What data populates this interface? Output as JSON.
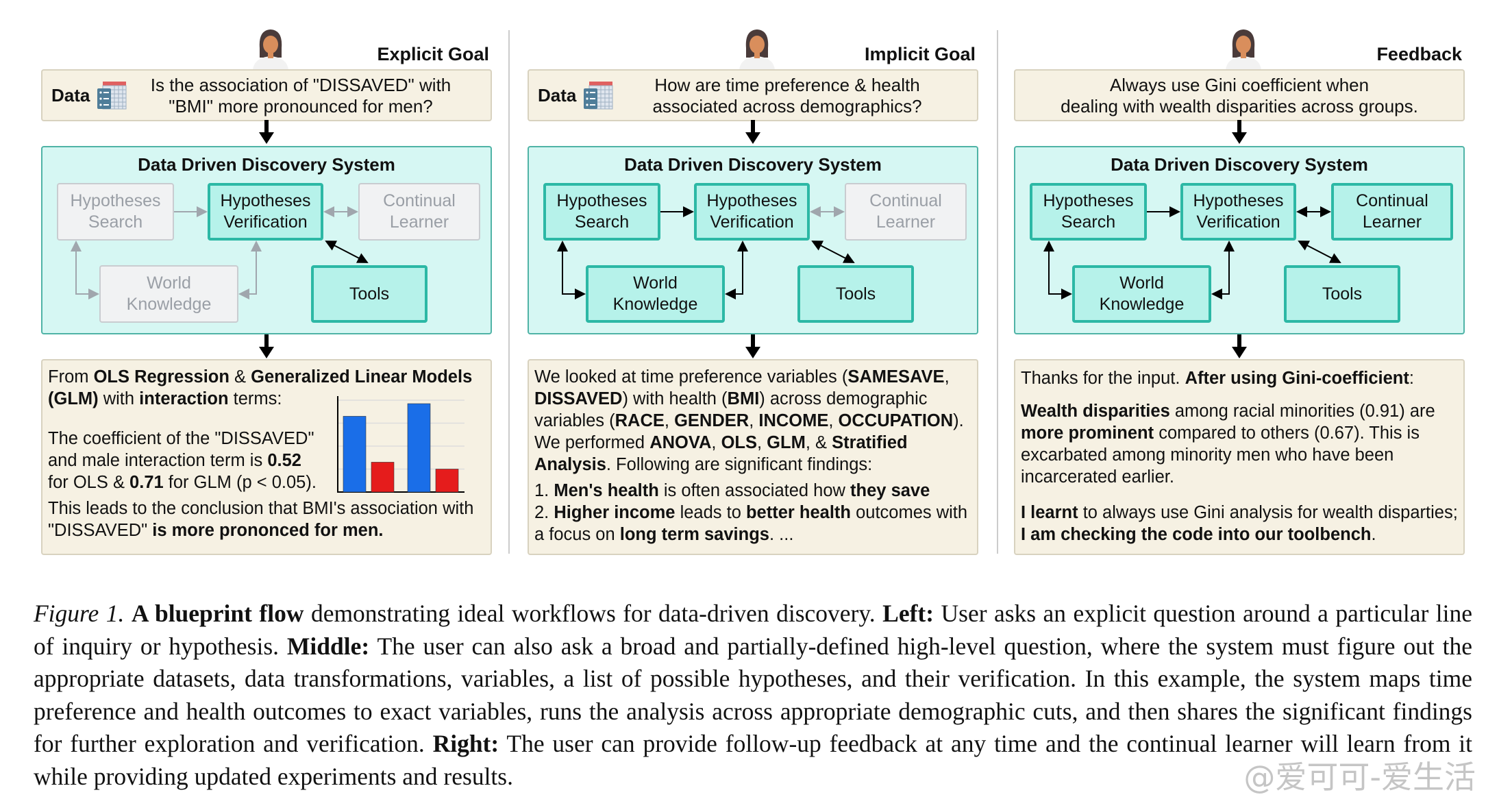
{
  "panels": [
    {
      "goal_label": "Explicit Goal",
      "data_label": "Data",
      "question_lines": [
        "Is  the association of \"DISSAVED\" with",
        "\"BMI\" more pronounced for men?"
      ],
      "system_title": "Data Driven Discovery System",
      "modules": {
        "hs": {
          "label": "Hypotheses\nSearch",
          "active": false
        },
        "hv": {
          "label": "Hypotheses\nVerification",
          "active": true
        },
        "cl": {
          "label": "Continual\nLearner",
          "active": false
        },
        "wk": {
          "label": "World\nKnowledge",
          "active": false
        },
        "tools": {
          "label": "Tools",
          "active": true
        }
      },
      "result_paragraphs": [
        [
          [
            {
              "t": "From "
            },
            {
              "t": "OLS Regression",
              "b": true
            },
            {
              "t": " & "
            },
            {
              "t": "Generalized Linear Models",
              "b": true
            }
          ],
          [
            {
              "t": "(GLM)",
              "b": true
            },
            {
              "t": " with "
            },
            {
              "t": "interaction",
              "b": true
            },
            {
              "t": " terms:"
            }
          ]
        ],
        [
          [
            {
              "t": "The coefficient of the \"DISSAVED\""
            }
          ],
          [
            {
              "t": "and male interaction term is "
            },
            {
              "t": "0.52",
              "b": true
            }
          ],
          [
            {
              "t": "for OLS & "
            },
            {
              "t": "0.71",
              "b": true
            },
            {
              "t": " for GLM  (p < 0.05)."
            }
          ]
        ],
        [
          [
            {
              "t": "This leads to the conclusion that BMI's association with"
            }
          ],
          [
            {
              "t": "\"DISSAVED\" "
            },
            {
              "t": "is more prononced for men.",
              "b": true
            }
          ]
        ]
      ]
    },
    {
      "goal_label": "Implicit Goal",
      "data_label": "Data",
      "question_lines": [
        "How are time preference & health",
        "associated across demographics?"
      ],
      "system_title": "Data Driven Discovery System",
      "modules": {
        "hs": {
          "label": "Hypotheses\nSearch",
          "active": true
        },
        "hv": {
          "label": "Hypotheses\nVerification",
          "active": true
        },
        "cl": {
          "label": "Continual\nLearner",
          "active": false
        },
        "wk": {
          "label": "World\nKnowledge",
          "active": true
        },
        "tools": {
          "label": "Tools",
          "active": true
        }
      },
      "result_paragraphs": [
        [
          [
            {
              "t": "We looked at time preference variables ("
            },
            {
              "t": "SAMESAVE",
              "b": true
            },
            {
              "t": ","
            }
          ],
          [
            {
              "t": "DISSAVED",
              "b": true
            },
            {
              "t": ") with health ("
            },
            {
              "t": "BMI",
              "b": true
            },
            {
              "t": ") across demographic"
            }
          ],
          [
            {
              "t": "variables ("
            },
            {
              "t": "RACE",
              "b": true
            },
            {
              "t": ", "
            },
            {
              "t": "GENDER",
              "b": true
            },
            {
              "t": ", "
            },
            {
              "t": "INCOME",
              "b": true
            },
            {
              "t": ", "
            },
            {
              "t": "OCCUPATION",
              "b": true
            },
            {
              "t": ")."
            }
          ],
          [
            {
              "t": "We performed "
            },
            {
              "t": "ANOVA",
              "b": true
            },
            {
              "t": ", "
            },
            {
              "t": "OLS",
              "b": true
            },
            {
              "t": ", "
            },
            {
              "t": "GLM",
              "b": true
            },
            {
              "t": ", & "
            },
            {
              "t": "Stratified",
              "b": true
            }
          ],
          [
            {
              "t": "Analysis",
              "b": true
            },
            {
              "t": ". Following are significant findings:"
            }
          ]
        ],
        [
          [
            {
              "t": "1. "
            },
            {
              "t": "Men's health",
              "b": true
            },
            {
              "t": " is often associated how "
            },
            {
              "t": "they save",
              "b": true
            }
          ],
          [
            {
              "t": "2. "
            },
            {
              "t": "Higher income",
              "b": true
            },
            {
              "t": " leads to "
            },
            {
              "t": "better health",
              "b": true
            },
            {
              "t": " outcomes with"
            }
          ],
          [
            {
              "t": "a focus on "
            },
            {
              "t": "long term savings",
              "b": true
            },
            {
              "t": ".  ..."
            }
          ]
        ]
      ]
    },
    {
      "goal_label": "Feedback",
      "question_lines": [
        "Always use Gini coefficient when",
        "dealing with wealth disparities across groups."
      ],
      "system_title": "Data Driven Discovery System",
      "modules": {
        "hs": {
          "label": "Hypotheses\nSearch",
          "active": true
        },
        "hv": {
          "label": "Hypotheses\nVerification",
          "active": true
        },
        "cl": {
          "label": "Continual\nLearner",
          "active": true
        },
        "wk": {
          "label": "World\nKnowledge",
          "active": true
        },
        "tools": {
          "label": "Tools",
          "active": true
        }
      },
      "result_paragraphs": [
        [
          [
            {
              "t": "Thanks for the input. "
            },
            {
              "t": "After using Gini-coefficient",
              "b": true
            },
            {
              "t": ":"
            }
          ]
        ],
        [
          [
            {
              "t": "Wealth disparities",
              "b": true
            },
            {
              "t": " among racial minorities (0.91) are"
            }
          ],
          [
            {
              "t": "more prominent",
              "b": true
            },
            {
              "t": " compared to others (0.67). This is"
            }
          ],
          [
            {
              "t": "excarbated among minority men who have been"
            }
          ],
          [
            {
              "t": "incarcerated earlier."
            }
          ]
        ],
        [
          [
            {
              "t": "I learnt",
              "b": true
            },
            {
              "t": " to always use Gini analysis for wealth disparties;"
            }
          ],
          [
            {
              "t": "I am checking the code into our toolbench",
              "b": true
            },
            {
              "t": "."
            }
          ]
        ]
      ]
    }
  ],
  "chart_data": {
    "type": "bar",
    "categories": [
      "",
      ""
    ],
    "series": [
      {
        "values": [
          3.3,
          3.85
        ],
        "color": "#1a6ee8"
      },
      {
        "values": [
          1.3,
          1.0
        ],
        "color": "#e51c1c"
      }
    ],
    "ylim": [
      0,
      4
    ],
    "grid": true,
    "xlabel": "",
    "ylabel": "",
    "title": ""
  },
  "colors": {
    "active_fill": "#b6f2ea",
    "active_border": "#2cb8a5",
    "inactive_fill": "#f1f2f3",
    "inactive_border": "#c9ccd0",
    "system_fill": "#d6f7f3",
    "note_fill": "#f6f1e3"
  },
  "caption": [
    {
      "t": "Figure 1.",
      "i": true
    },
    {
      "t": " "
    },
    {
      "t": "A blueprint flow",
      "b": true
    },
    {
      "t": " demonstrating ideal workflows for data-driven discovery.  "
    },
    {
      "t": "Left:",
      "b": true
    },
    {
      "t": " User asks an explicit question around a particular line of inquiry or hypothesis.  "
    },
    {
      "t": "Middle:",
      "b": true
    },
    {
      "t": " The user can also ask a broad and partially-defined high-level question, where the system must figure out the appropriate datasets, data transformations, variables, a list of possible hypotheses, and their verification. In this example, the system maps time preference and health outcomes to exact variables, runs the analysis across appropriate demographic cuts, and then shares the significant findings for further exploration and verification.  "
    },
    {
      "t": "Right:",
      "b": true
    },
    {
      "t": " The user can provide follow-up feedback at any time and the continual learner will learn from it while providing updated experiments and results."
    }
  ],
  "watermark": "@爱可可-爱生活"
}
